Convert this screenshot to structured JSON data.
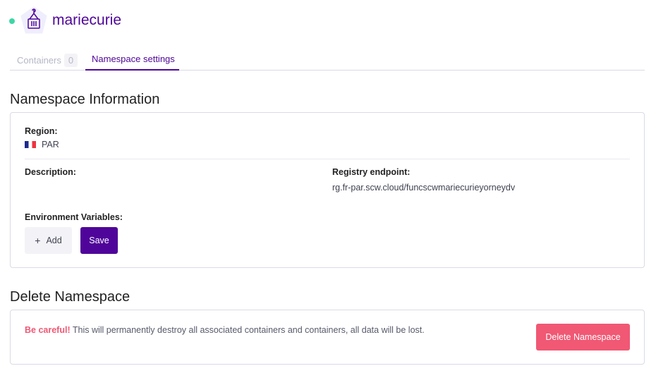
{
  "header": {
    "title": "mariecurie",
    "status_color": "#3ed6a6",
    "icon": "container-icon"
  },
  "tabs": [
    {
      "label": "Containers",
      "count": "0"
    },
    {
      "label": "Namespace settings",
      "active": true
    }
  ],
  "info": {
    "heading": "Namespace Information",
    "region_label": "Region:",
    "region_value": "PAR",
    "region_flag": "france-flag-icon",
    "description_label": "Description:",
    "registry_label": "Registry endpoint:",
    "registry_value": "rg.fr-par.scw.cloud/funcscwmariecurieyorneydv",
    "env_label": "Environment Variables:",
    "add_label": "Add",
    "save_label": "Save"
  },
  "delete": {
    "heading": "Delete Namespace",
    "warning_strong": "Be careful!",
    "warning_text": " This will permanently destroy all associated containers and containers, all data will be lost.",
    "button_label": "Delete Namespace"
  },
  "colors": {
    "brand": "#4f0599",
    "danger": "#f05874"
  }
}
